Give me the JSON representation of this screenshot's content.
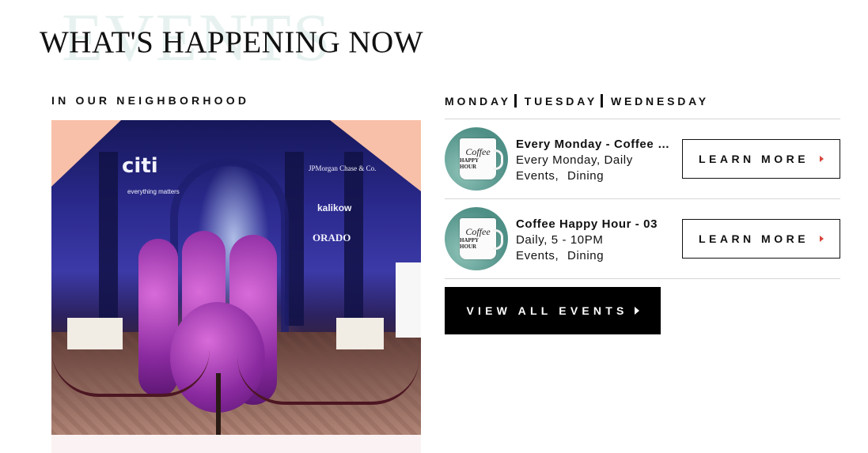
{
  "header": {
    "background_word": "EVENTS",
    "title": "WHAT'S HAPPENING NOW"
  },
  "neighborhood": {
    "label": "IN OUR NEIGHBORHOOD",
    "photo_signage": {
      "citi": "citi",
      "jpmorgan": "JPMorgan Chase & Co.",
      "kalikow": "kalikow",
      "orado": "ORADO",
      "small": "everything matters"
    }
  },
  "schedule": {
    "days": [
      "MONDAY",
      "TUESDAY",
      "WEDNESDAY"
    ]
  },
  "events": [
    {
      "title": "Every Monday - Coffee Happy Hour",
      "when": "Every Monday, Daily",
      "categories": [
        "Events",
        "Dining"
      ],
      "thumb_line1": "Coffee",
      "thumb_line2": "HAPPY HOUR",
      "button_label": "LEARN MORE"
    },
    {
      "title": "Coffee Happy Hour - 03",
      "when": "Daily, 5 - 10PM",
      "categories": [
        "Events",
        "Dining"
      ],
      "thumb_line1": "Coffee",
      "thumb_line2": "HAPPY HOUR",
      "button_label": "LEARN MORE"
    }
  ],
  "view_all": {
    "label": "VIEW ALL EVENTS"
  },
  "colors": {
    "accent_arrow": "#d6463b",
    "button_dark": "#000000",
    "watermark": "#e7f2f0"
  }
}
